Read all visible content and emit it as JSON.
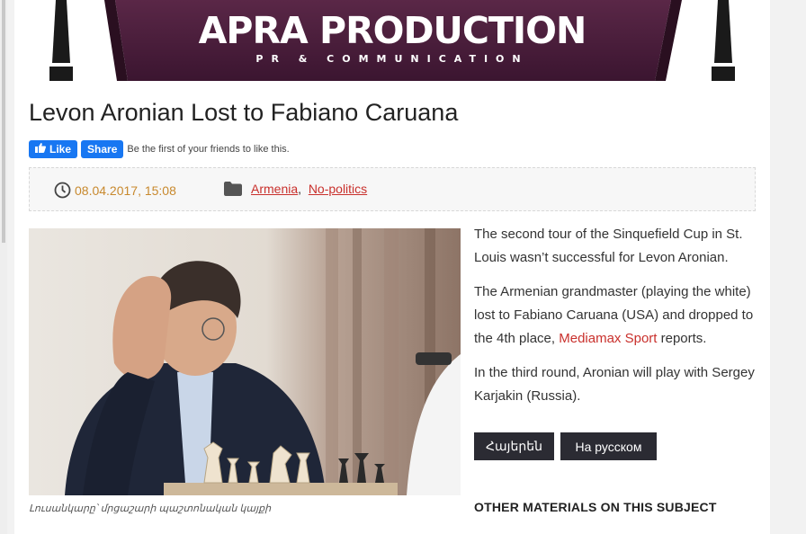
{
  "banner": {
    "logo_text": "APRA PRODUCTION",
    "tagline": "PR & COMMUNICATION",
    "colors": {
      "background": "#4a1f3a",
      "band": "#2a0f20",
      "text": "#ffffff"
    }
  },
  "article": {
    "title": "Levon Aronian Lost to Fabiano Caruana",
    "facebook": {
      "like_label": "Like",
      "share_label": "Share",
      "social_text": "Be the first of your friends to like this."
    },
    "meta": {
      "date": "08.04.2017, 15:08",
      "categories": [
        "Armenia",
        "No-politics"
      ],
      "separator": ","
    },
    "photo": {
      "description_icon": "chess-player-photo",
      "caption": "Լուսանկարը՝ մրցաշարի պաշտոնական կայքի"
    },
    "paragraphs": {
      "p1": "The second tour of the Sinquefield Cup in St. Louis wasn’t successful for Levon Aronian.",
      "p2_before": "The Armenian grandmaster (playing the white) lost to Fabiano Caruana (USA) and dropped to the 4th place, ",
      "p2_link": "Mediamax Sport",
      "p2_after": " reports.",
      "p3": "In the third round, Aronian will play with Sergey Karjakin (Russia)."
    },
    "language_buttons": [
      "Հայերեն",
      "На русском"
    ],
    "related_heading": "OTHER MATERIALS ON THIS SUBJECT"
  },
  "colors": {
    "accent_date": "#c8892e",
    "link": "#c9302c",
    "facebook": "#1877f2",
    "button_dark": "#2b2b33"
  }
}
